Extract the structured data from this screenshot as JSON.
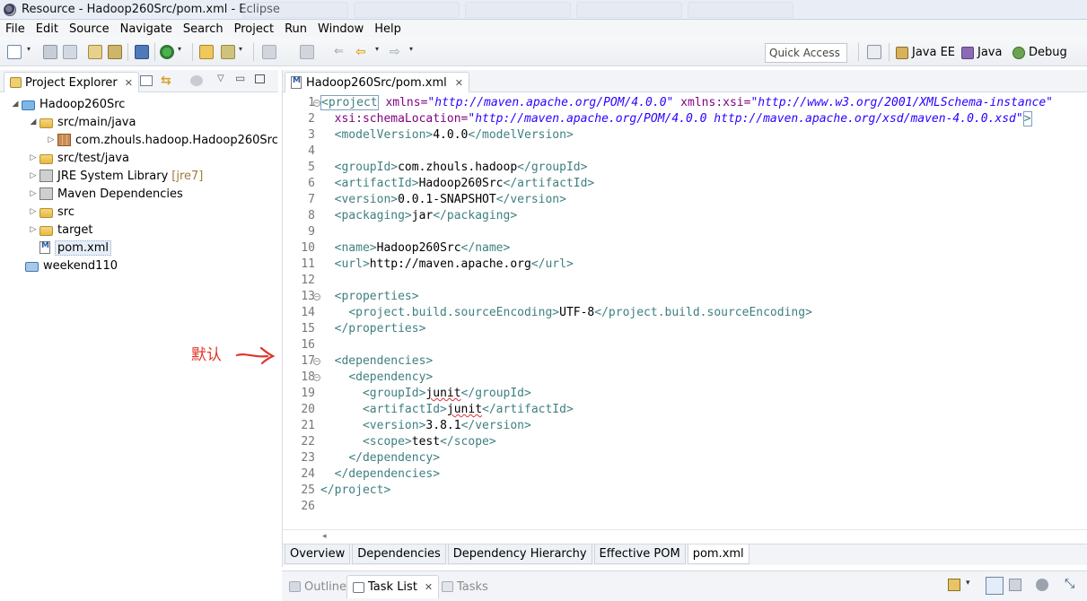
{
  "window": {
    "title": "Resource - Hadoop260Src/pom.xml - Eclipse"
  },
  "menubar": [
    "File",
    "Edit",
    "Source",
    "Navigate",
    "Search",
    "Project",
    "Run",
    "Window",
    "Help"
  ],
  "toolbar": {
    "quick_access": "Quick Access",
    "perspectives": [
      "Java EE",
      "Java",
      "Debug"
    ]
  },
  "project_explorer": {
    "tab_label": "Project Explorer",
    "tree": [
      {
        "label": "Hadoop260Src",
        "icon": "project-icon",
        "expanded": true
      },
      {
        "label": "src/main/java",
        "icon": "source-folder-icon",
        "expanded": true
      },
      {
        "label": "com.zhouls.hadoop.Hadoop260Src",
        "icon": "package-icon",
        "expanded": false
      },
      {
        "label": "src/test/java",
        "icon": "source-folder-icon",
        "expanded": false
      },
      {
        "label": "JRE System Library",
        "decoration": "[jre7]",
        "icon": "library-icon",
        "expanded": false
      },
      {
        "label": "Maven Dependencies",
        "icon": "library-icon",
        "expanded": false
      },
      {
        "label": "src",
        "icon": "folder-icon",
        "expanded": false
      },
      {
        "label": "target",
        "icon": "folder-icon",
        "expanded": false
      },
      {
        "label": "pom.xml",
        "icon": "xml-file-icon",
        "selected": true
      },
      {
        "label": "weekend110",
        "icon": "project-icon",
        "closed": true
      }
    ]
  },
  "annotation": {
    "text": "默认"
  },
  "editor": {
    "tab_label": "Hadoop260Src/pom.xml",
    "lines": [
      {
        "n": "1",
        "fold": true
      },
      {
        "n": "2"
      },
      {
        "n": "3"
      },
      {
        "n": "4"
      },
      {
        "n": "5"
      },
      {
        "n": "6"
      },
      {
        "n": "7"
      },
      {
        "n": "8"
      },
      {
        "n": "9"
      },
      {
        "n": "10"
      },
      {
        "n": "11"
      },
      {
        "n": "12"
      },
      {
        "n": "13",
        "fold": true
      },
      {
        "n": "14"
      },
      {
        "n": "15"
      },
      {
        "n": "16"
      },
      {
        "n": "17",
        "fold": true
      },
      {
        "n": "18",
        "fold": true
      },
      {
        "n": "19"
      },
      {
        "n": "20"
      },
      {
        "n": "21"
      },
      {
        "n": "22"
      },
      {
        "n": "23"
      },
      {
        "n": "24"
      },
      {
        "n": "25"
      },
      {
        "n": "26"
      }
    ],
    "code": {
      "l1_tag": "<project",
      "l1_a1": " xmlns=",
      "l1_v1": "\"http://maven.apache.org/POM/4.0.0\"",
      "l1_a2": " xmlns:xsi=",
      "l1_v2": "\"http://www.w3.org/2001/XMLSchema-instance\"",
      "l2_a": "  xsi:schemaLocation=",
      "l2_v": "\"http://maven.apache.org/POM/4.0.0 http://maven.apache.org/xsd/maven-4.0.0.xsd\"",
      "l2_end": ">",
      "modelVersion": "4.0.0",
      "groupId": "com.zhouls.hadoop",
      "artifactId": "Hadoop260Src",
      "version": "0.0.1-SNAPSHOT",
      "packaging": "jar",
      "name": "Hadoop260Src",
      "url": "http://maven.apache.org",
      "sourceEncoding": "UTF-8",
      "dep_groupId": "junit",
      "dep_artifactId": "junit",
      "dep_version": "3.8.1",
      "dep_scope": "test"
    },
    "bottom_tabs": [
      "Overview",
      "Dependencies",
      "Dependency Hierarchy",
      "Effective POM",
      "pom.xml"
    ],
    "active_bottom_tab": "pom.xml"
  },
  "bottom_panel": {
    "tabs": [
      "Outline",
      "Task List",
      "Tasks"
    ],
    "active": "Task List"
  },
  "colors": {
    "tag": "#3f7f7f",
    "attribute": "#7f007f",
    "string": "#2a00ff",
    "annotation": "#e0342a"
  }
}
